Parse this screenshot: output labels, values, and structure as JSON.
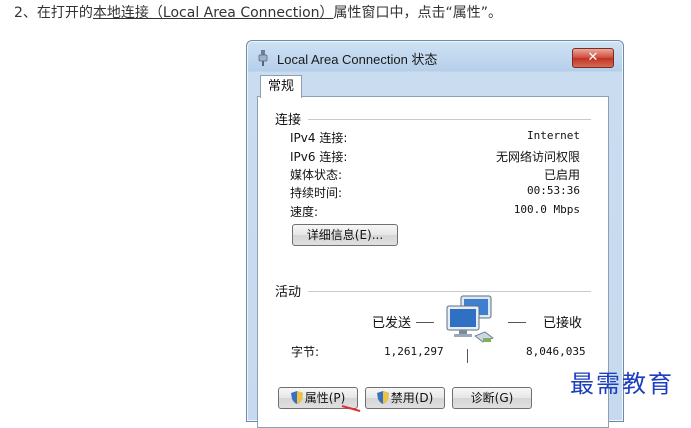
{
  "instruction": {
    "prefix": "2、在打开的",
    "link": "本地连接（Local Area Connection）",
    "suffix": "属性窗口中，点击“属性”。"
  },
  "window": {
    "title": "Local Area Connection 状态",
    "close_glyph": "✕",
    "tab": "常规"
  },
  "connection": {
    "section_label": "连接",
    "rows": [
      {
        "label": "IPv4 连接:",
        "value": "Internet"
      },
      {
        "label": "IPv6 连接:",
        "value": "无网络访问权限"
      },
      {
        "label": "媒体状态:",
        "value": "已启用"
      },
      {
        "label": "持续时间:",
        "value": "00:53:36"
      },
      {
        "label": "速度:",
        "value": "100.0 Mbps"
      }
    ],
    "details_button": "详细信息(E)..."
  },
  "activity": {
    "section_label": "活动",
    "sent_label": "已发送",
    "received_label": "已接收",
    "bytes_label": "字节:",
    "bytes_sent": "1,261,297",
    "bytes_received": "8,046,035",
    "icon": "network-computers-icon"
  },
  "buttons": {
    "properties": "属性(P)",
    "disable": "禁用(D)",
    "diagnose": "诊断(G)"
  },
  "watermark": "最需教育",
  "colors": {
    "title_bar": "#b6cfe9",
    "close_button": "#c2321f",
    "watermark": "#1c3fbf"
  }
}
